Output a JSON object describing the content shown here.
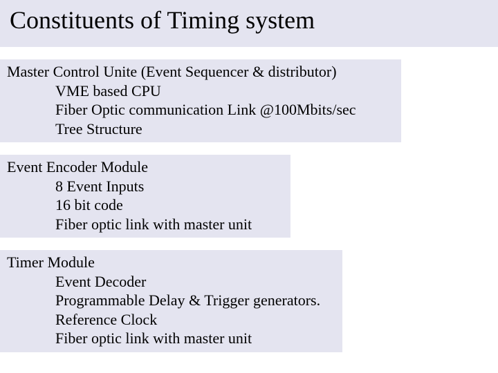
{
  "title": "Constituents of Timing system",
  "sections": [
    {
      "heading": "Master Control Unite (Event Sequencer & distributor)",
      "items": [
        "VME based CPU",
        "Fiber Optic communication Link @100Mbits/sec",
        "Tree Structure"
      ]
    },
    {
      "heading": "Event Encoder Module",
      "items": [
        "8 Event Inputs",
        "16 bit code",
        "Fiber optic link with master unit"
      ]
    },
    {
      "heading": "Timer Module",
      "items": [
        "Event Decoder",
        "Programmable Delay & Trigger generators.",
        "Reference Clock",
        "Fiber optic link with master unit"
      ]
    }
  ]
}
